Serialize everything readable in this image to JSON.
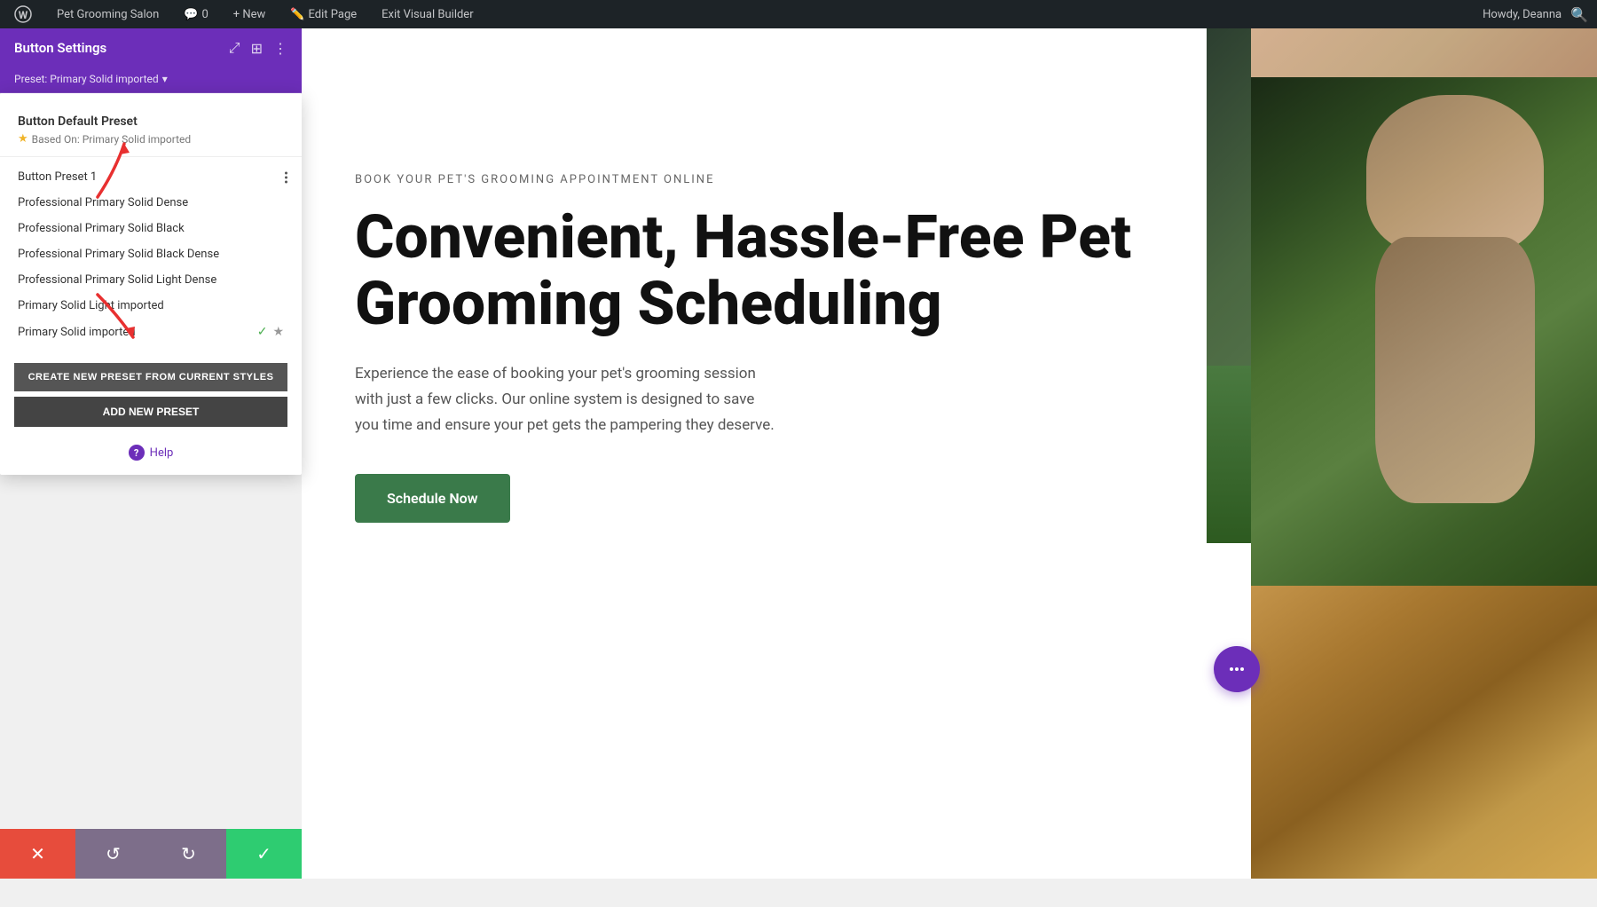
{
  "adminBar": {
    "siteName": "Pet Grooming Salon",
    "commentCount": "0",
    "newLabel": "+ New",
    "editPageLabel": "Edit Page",
    "exitBuilderLabel": "Exit Visual Builder",
    "howdyText": "Howdy, Deanna",
    "searchIcon": "search"
  },
  "panel": {
    "title": "Button Settings",
    "presetLabel": "Preset: Primary Solid imported",
    "icons": {
      "maximize": "⤢",
      "layout": "⊞",
      "dots": "⋮"
    }
  },
  "dropdown": {
    "defaultPreset": {
      "title": "Button Default Preset",
      "basedOn": "Based On: Primary Solid imported",
      "starIcon": "★"
    },
    "presets": [
      {
        "id": 1,
        "label": "Button Preset 1",
        "hasDotsMenu": true,
        "isActive": false,
        "isStarred": false
      },
      {
        "id": 2,
        "label": "Professional Primary Solid Dense",
        "hasDotsMenu": false,
        "isActive": false,
        "isStarred": false
      },
      {
        "id": 3,
        "label": "Professional Primary Solid Black",
        "hasDotsMenu": false,
        "isActive": false,
        "isStarred": false
      },
      {
        "id": 4,
        "label": "Professional Primary Solid Black Dense",
        "hasDotsMenu": false,
        "isActive": false,
        "isStarred": false
      },
      {
        "id": 5,
        "label": "Professional Primary Solid Light Dense",
        "hasDotsMenu": false,
        "isActive": false,
        "isStarred": false
      },
      {
        "id": 6,
        "label": "Primary Solid Light imported",
        "hasDotsMenu": false,
        "isActive": false,
        "isStarred": false
      },
      {
        "id": 7,
        "label": "Primary Solid imported",
        "hasDotsMenu": false,
        "isActive": true,
        "isStarred": true,
        "checkIcon": "✓",
        "starIcon": "★"
      }
    ],
    "createPresetBtn": "CREATE NEW PRESET FROM CURRENT STYLES",
    "addPresetBtn": "ADD NEW PRESET",
    "helpLabel": "Help",
    "helpIcon": "?"
  },
  "bottomToolbar": {
    "cancelIcon": "✕",
    "undoIcon": "↺",
    "redoIcon": "↻",
    "saveIcon": "✓"
  },
  "hero": {
    "subtitle": "BOOK YOUR PET'S GROOMING APPOINTMENT ONLINE",
    "title": "Convenient, Hassle-Free Pet Grooming Scheduling",
    "description": "Experience the ease of booking your pet's grooming session with just a few clicks. Our online system is designed to save you time and ensure your pet gets the pampering they deserve.",
    "ctaButton": "Schedule Now"
  },
  "fab": {
    "icon": "•••"
  }
}
